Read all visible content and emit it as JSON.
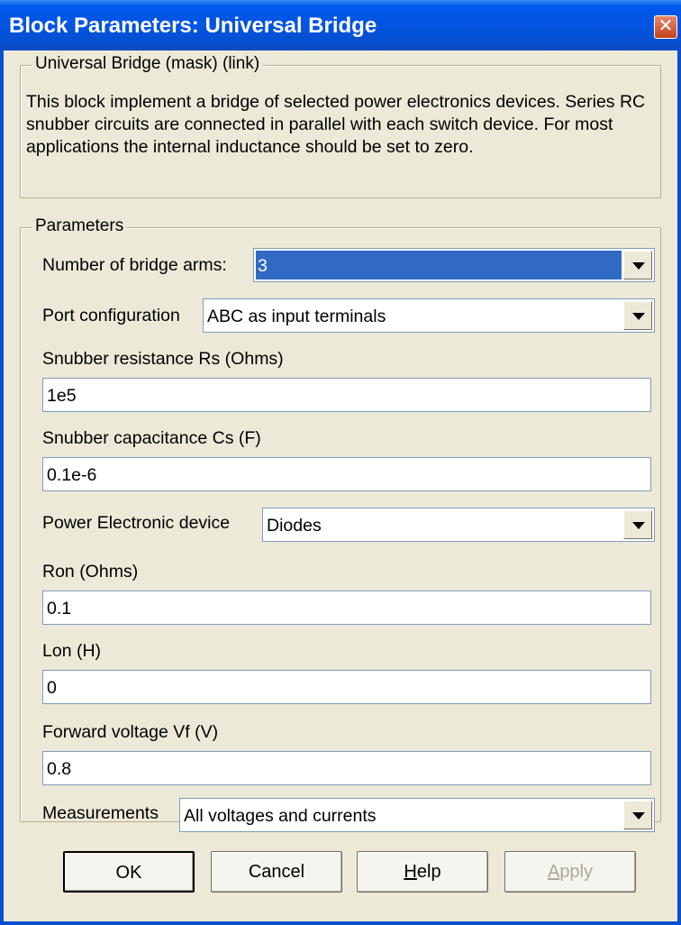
{
  "window": {
    "title": "Block Parameters: Universal Bridge",
    "close_icon": "close-icon"
  },
  "description_group": {
    "legend": "Universal Bridge (mask) (link)",
    "text": "This block implement a bridge of selected power electronics devices. Series RC snubber circuits are connected in parallel with each switch device.  For most applications the internal inductance should be set to zero."
  },
  "parameters_group": {
    "legend": "Parameters",
    "bridge_arms": {
      "label": "Number of bridge arms:",
      "value": "3"
    },
    "port_config": {
      "label": "Port configuration",
      "value": "ABC as input terminals"
    },
    "snubber_resistance": {
      "label": "Snubber resistance Rs (Ohms)",
      "value": "1e5"
    },
    "snubber_capacitance": {
      "label": "Snubber capacitance Cs (F)",
      "value": "0.1e-6"
    },
    "device": {
      "label": "Power Electronic device",
      "value": "Diodes"
    },
    "ron": {
      "label": "Ron (Ohms)",
      "value": "0.1"
    },
    "lon": {
      "label": "Lon (H)",
      "value": "0"
    },
    "forward_voltage": {
      "label": "Forward voltage Vf (V)",
      "value": "0.8"
    },
    "measurements": {
      "label": "Measurements",
      "value": "All voltages and currents"
    }
  },
  "buttons": {
    "ok": "OK",
    "cancel": "Cancel",
    "help_prefix": "H",
    "help_rest": "elp",
    "apply_prefix": "A",
    "apply_rest": "pply"
  },
  "colors": {
    "titlebar": "#0453dd",
    "dialog_bg": "#ece9d8",
    "selection": "#316ac5"
  }
}
